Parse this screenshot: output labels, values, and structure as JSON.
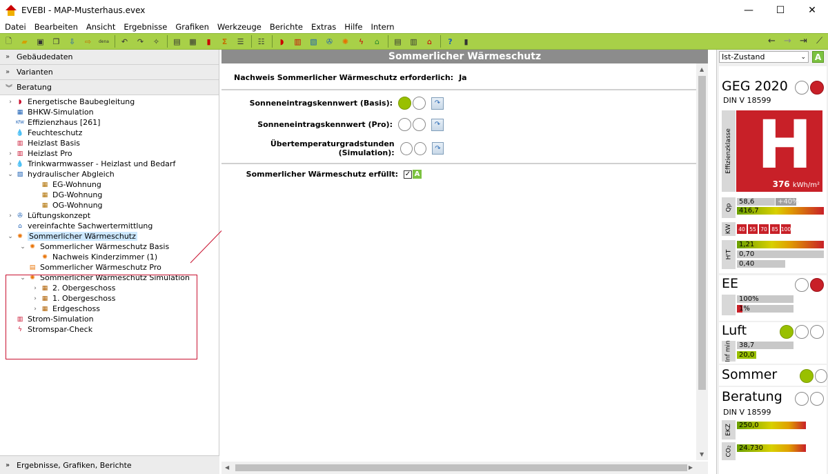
{
  "window": {
    "title": "EVEBI - MAP-Musterhaus.evex"
  },
  "menu": [
    "Datei",
    "Bearbeiten",
    "Ansicht",
    "Ergebnisse",
    "Grafiken",
    "Werkzeuge",
    "Berichte",
    "Extras",
    "Hilfe",
    "Intern"
  ],
  "left": {
    "sections_top": [
      "Gebäudedaten",
      "Varianten",
      "Beratung"
    ],
    "tree": [
      {
        "label": "Energetische Baubegleitung",
        "exp": "›",
        "indent": 0,
        "icon": "hat-icon"
      },
      {
        "label": "BHKW-Simulation",
        "exp": "",
        "indent": 0,
        "icon": "chp-icon"
      },
      {
        "label": "Effizienzhaus [261]",
        "exp": "",
        "indent": 0,
        "icon": "kfw-icon"
      },
      {
        "label": "Feuchteschutz",
        "exp": "",
        "indent": 0,
        "icon": "drop-icon"
      },
      {
        "label": "Heizlast Basis",
        "exp": "",
        "indent": 0,
        "icon": "heatload-icon"
      },
      {
        "label": "Heizlast Pro",
        "exp": "›",
        "indent": 0,
        "icon": "heatload-icon"
      },
      {
        "label": "Trinkwarmwasser - Heizlast und Bedarf",
        "exp": "›",
        "indent": 0,
        "icon": "water-icon"
      },
      {
        "label": "hydraulischer Abgleich",
        "exp": "⌄",
        "indent": 0,
        "icon": "hydraulic-icon"
      },
      {
        "label": "EG-Wohnung",
        "exp": "",
        "indent": 2,
        "icon": "apartment-icon"
      },
      {
        "label": "DG-Wohnung",
        "exp": "",
        "indent": 2,
        "icon": "apartment-icon"
      },
      {
        "label": "OG-Wohnung",
        "exp": "",
        "indent": 2,
        "icon": "apartment-icon"
      },
      {
        "label": "Lüftungskonzept",
        "exp": "›",
        "indent": 0,
        "icon": "ventilation-icon"
      },
      {
        "label": "vereinfachte Sachwertermittlung",
        "exp": "",
        "indent": 0,
        "icon": "house-icon"
      },
      {
        "label": "Sommerlicher Wärmeschutz",
        "exp": "⌄",
        "indent": 0,
        "icon": "sun-icon",
        "selected": true
      },
      {
        "label": "Sommerlicher Wärmeschutz Basis",
        "exp": "⌄",
        "indent": 1,
        "icon": "sun-icon"
      },
      {
        "label": "Nachweis Kinderzimmer (1)",
        "exp": "",
        "indent": 2,
        "icon": "sun-icon"
      },
      {
        "label": "Sommerlicher Wärmeschutz Pro",
        "exp": "",
        "indent": 1,
        "icon": "window-icon"
      },
      {
        "label": "Sommerlicher Wärmeschutz Simulation",
        "exp": "⌄",
        "indent": 1,
        "icon": "sun-sim-icon"
      },
      {
        "label": "2. Obergeschoss",
        "exp": "›",
        "indent": 2,
        "icon": "floor-icon"
      },
      {
        "label": "1. Obergeschoss",
        "exp": "›",
        "indent": 2,
        "icon": "floor-icon"
      },
      {
        "label": "Erdgeschoss",
        "exp": "›",
        "indent": 2,
        "icon": "floor-icon"
      },
      {
        "label": "Strom-Simulation",
        "exp": "",
        "indent": 0,
        "icon": "power-sim-icon"
      },
      {
        "label": "Stromspar-Check",
        "exp": "",
        "indent": 0,
        "icon": "lightning-icon"
      }
    ],
    "bottom_section": "Ergebnisse, Grafiken, Berichte"
  },
  "center": {
    "title": "Sommerlicher Wärmeschutz",
    "required_label": "Nachweis Sommerlicher Wärmeschutz erforderlich:",
    "required_value": "Ja",
    "rows": [
      {
        "label": "Sonneneintragskennwert (Basis):",
        "first_green": true
      },
      {
        "label": "Sonneneintragskennwert (Pro):",
        "first_green": false
      },
      {
        "label": "Übertemperaturgradstunden (Simulation):",
        "first_green": false
      }
    ],
    "fulfilled_label": "Sommerlicher Wärmeschutz erfüllt:",
    "fulfilled_badge": "A"
  },
  "right": {
    "state": "Ist-Zustand",
    "state_badge": "A",
    "geg": {
      "title": "GEG 2020",
      "norm": "DIN V 18599",
      "class_letter": "H",
      "class_label": "Effizienzklasse",
      "kwh_value": "376",
      "kwh_unit": "kWh/m²",
      "qp_label": "Qp",
      "qp_values": [
        "58,6",
        "+40%",
        "416,7"
      ],
      "kw_label": "KW",
      "kw_values": [
        "40",
        "55",
        "70",
        "85",
        "100"
      ],
      "ht_label": "H'T",
      "ht_values": [
        "1,21",
        "0,70",
        "0,40"
      ]
    },
    "ee": {
      "title": "EE",
      "values": [
        "100%",
        "1%"
      ]
    },
    "luft": {
      "title": "Luft",
      "label": "Inf min",
      "values": [
        "38,7",
        "20,0"
      ]
    },
    "sommer": {
      "title": "Sommer"
    },
    "beratung": {
      "title": "Beratung",
      "norm": "DIN V 18599",
      "ekz_label": "EKZ",
      "ekz": "250,0",
      "co2_label": "CO₂",
      "co2": "24.730"
    },
    "colors": {
      "green": "#99c000",
      "red": "#c82028",
      "toolbar": "#a8d048"
    }
  }
}
